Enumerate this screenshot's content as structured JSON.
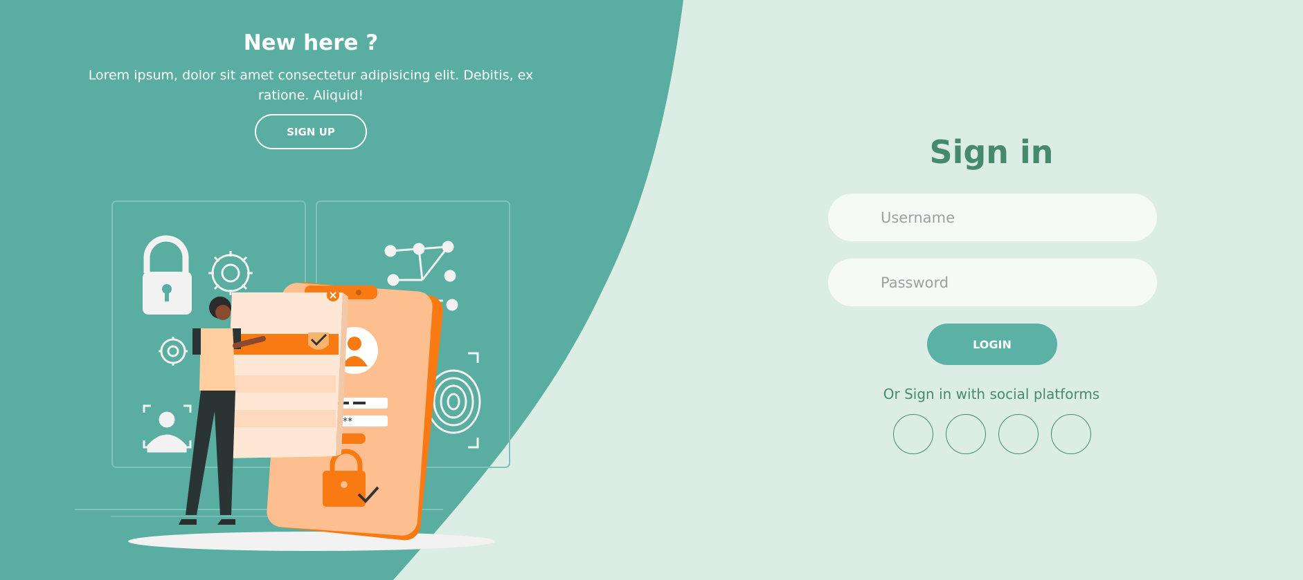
{
  "colors": {
    "panel_teal": "#59ada1",
    "background_mint": "#dcede5",
    "heading_green": "#468a6d",
    "button_teal": "#5ab1a4",
    "input_bg": "#f5faf7",
    "accent_orange": "#f97a12"
  },
  "left_panel": {
    "title": "New here ?",
    "text": "Lorem ipsum, dolor sit amet consectetur adipisicing elit. Debitis, ex ratione. Aliquid!",
    "signup_label": "SIGN UP",
    "illustration": "person-unlocking-phone-login-illustration"
  },
  "signin_form": {
    "title": "Sign in",
    "username_placeholder": "Username",
    "username_value": "",
    "password_placeholder": "Password",
    "password_value": "",
    "login_label": "LOGIN",
    "social_text": "Or Sign in with social platforms",
    "social_buttons": [
      {
        "icon": "social-icon-1",
        "glyph": ""
      },
      {
        "icon": "social-icon-2",
        "glyph": ""
      },
      {
        "icon": "social-icon-3",
        "glyph": ""
      },
      {
        "icon": "social-icon-4",
        "glyph": ""
      }
    ]
  }
}
